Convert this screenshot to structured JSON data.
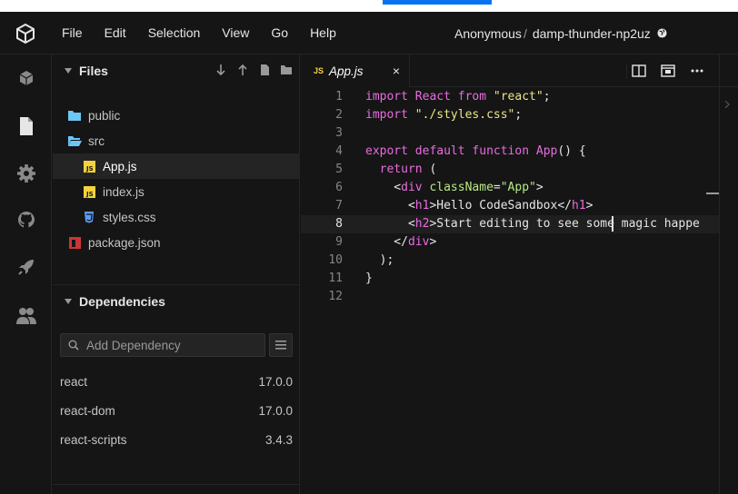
{
  "menu": [
    "File",
    "Edit",
    "Selection",
    "View",
    "Go",
    "Help"
  ],
  "sandbox": {
    "owner": "Anonymous",
    "separator": "/",
    "name": "damp-thunder-np2uz"
  },
  "activity_icons": [
    "cube-icon",
    "file-icon",
    "gear-icon",
    "github-icon",
    "rocket-icon",
    "users-icon"
  ],
  "files": {
    "title": "Files",
    "tree": [
      {
        "name": "public",
        "type": "folder"
      },
      {
        "name": "src",
        "type": "folder-open"
      },
      {
        "name": "App.js",
        "type": "js",
        "active": true
      },
      {
        "name": "index.js",
        "type": "js"
      },
      {
        "name": "styles.css",
        "type": "css"
      },
      {
        "name": "package.json",
        "type": "npm"
      }
    ]
  },
  "dependencies": {
    "title": "Dependencies",
    "search_placeholder": "Add Dependency",
    "items": [
      {
        "name": "react",
        "version": "17.0.0"
      },
      {
        "name": "react-dom",
        "version": "17.0.0"
      },
      {
        "name": "react-scripts",
        "version": "3.4.3"
      }
    ]
  },
  "editor": {
    "tab": {
      "badge": "JS",
      "name": "App.js",
      "close": "×"
    },
    "active_line": 8,
    "lines": [
      "1",
      "2",
      "3",
      "4",
      "5",
      "6",
      "7",
      "8",
      "9",
      "10",
      "11",
      "12"
    ]
  },
  "colors": {
    "background": "#151515",
    "accent": "#0971f1",
    "js_yellow": "#f3d23e",
    "folder_blue": "#6cc7f6",
    "npm_red": "#cc3534"
  }
}
